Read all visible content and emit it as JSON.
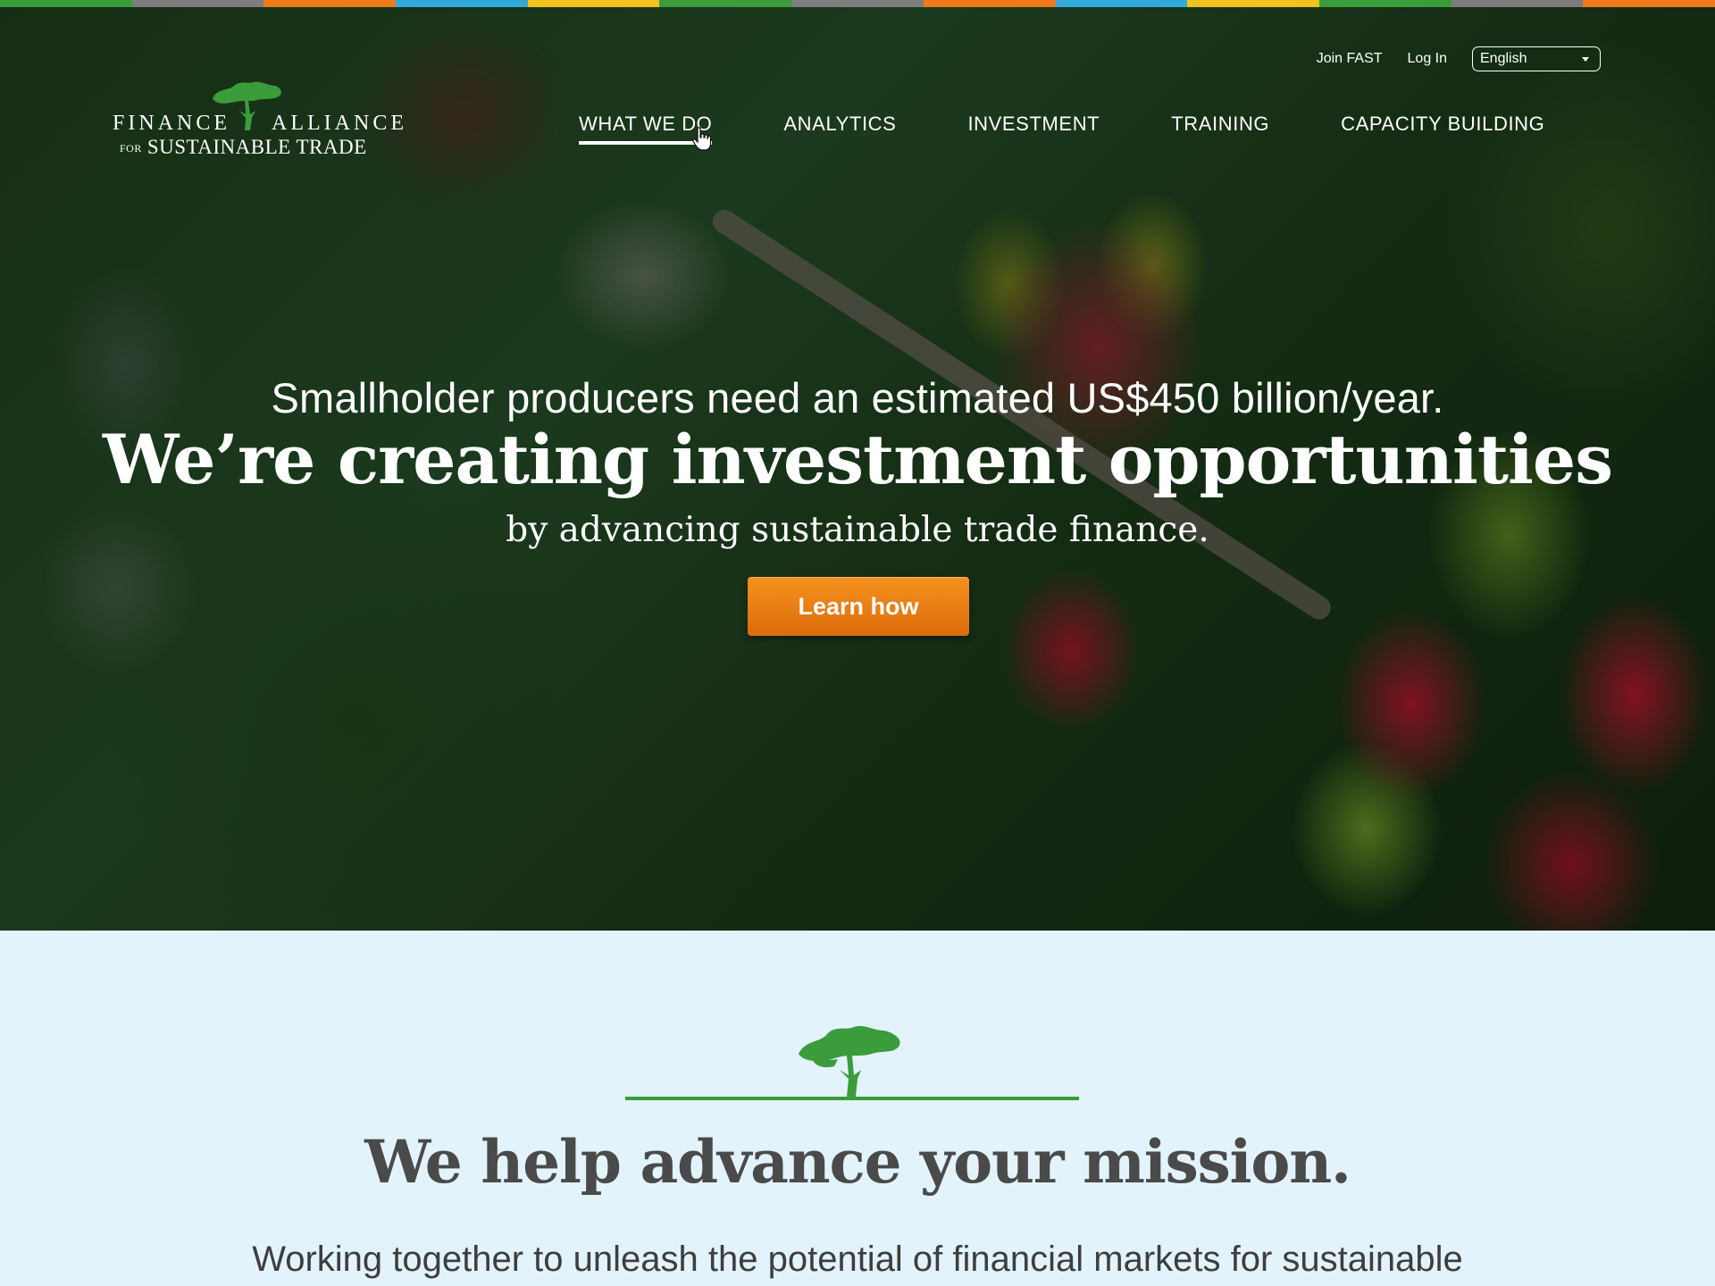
{
  "color_bar": [
    "#3a9c3a",
    "#7d7d7d",
    "#ef7a1a",
    "#33a8db",
    "#f3c21c",
    "#3a9c3a",
    "#7d7d7d",
    "#ef7a1a",
    "#33a8db",
    "#f3c21c",
    "#3a9c3a",
    "#7d7d7d",
    "#ef7a1a"
  ],
  "logo": {
    "word1": "FINANCE",
    "word2": "ALLIANCE",
    "for": "FOR",
    "line2": "SUSTAINABLE TRADE",
    "icon": "acacia-tree-icon"
  },
  "topbar": {
    "join": "Join FAST",
    "login": "Log In",
    "language": "English"
  },
  "nav": {
    "items": [
      "WHAT WE DO",
      "ANALYTICS",
      "INVESTMENT",
      "TRAINING",
      "CAPACITY BUILDING"
    ],
    "active": "WHAT WE DO"
  },
  "hero": {
    "subline": "Smallholder producers need an estimated US$450 billion/year.",
    "headline": "We’re creating investment opportunities",
    "subline2": "by advancing sustainable trade finance.",
    "cta": "Learn how"
  },
  "mission": {
    "title": "We help advance your mission.",
    "text": "Working together to unleash the potential of financial markets for sustainable"
  },
  "colors": {
    "accent_orange": "#ef7a1a",
    "tree_green": "#3a9c3a",
    "mission_bg": "#e3f3fb"
  }
}
